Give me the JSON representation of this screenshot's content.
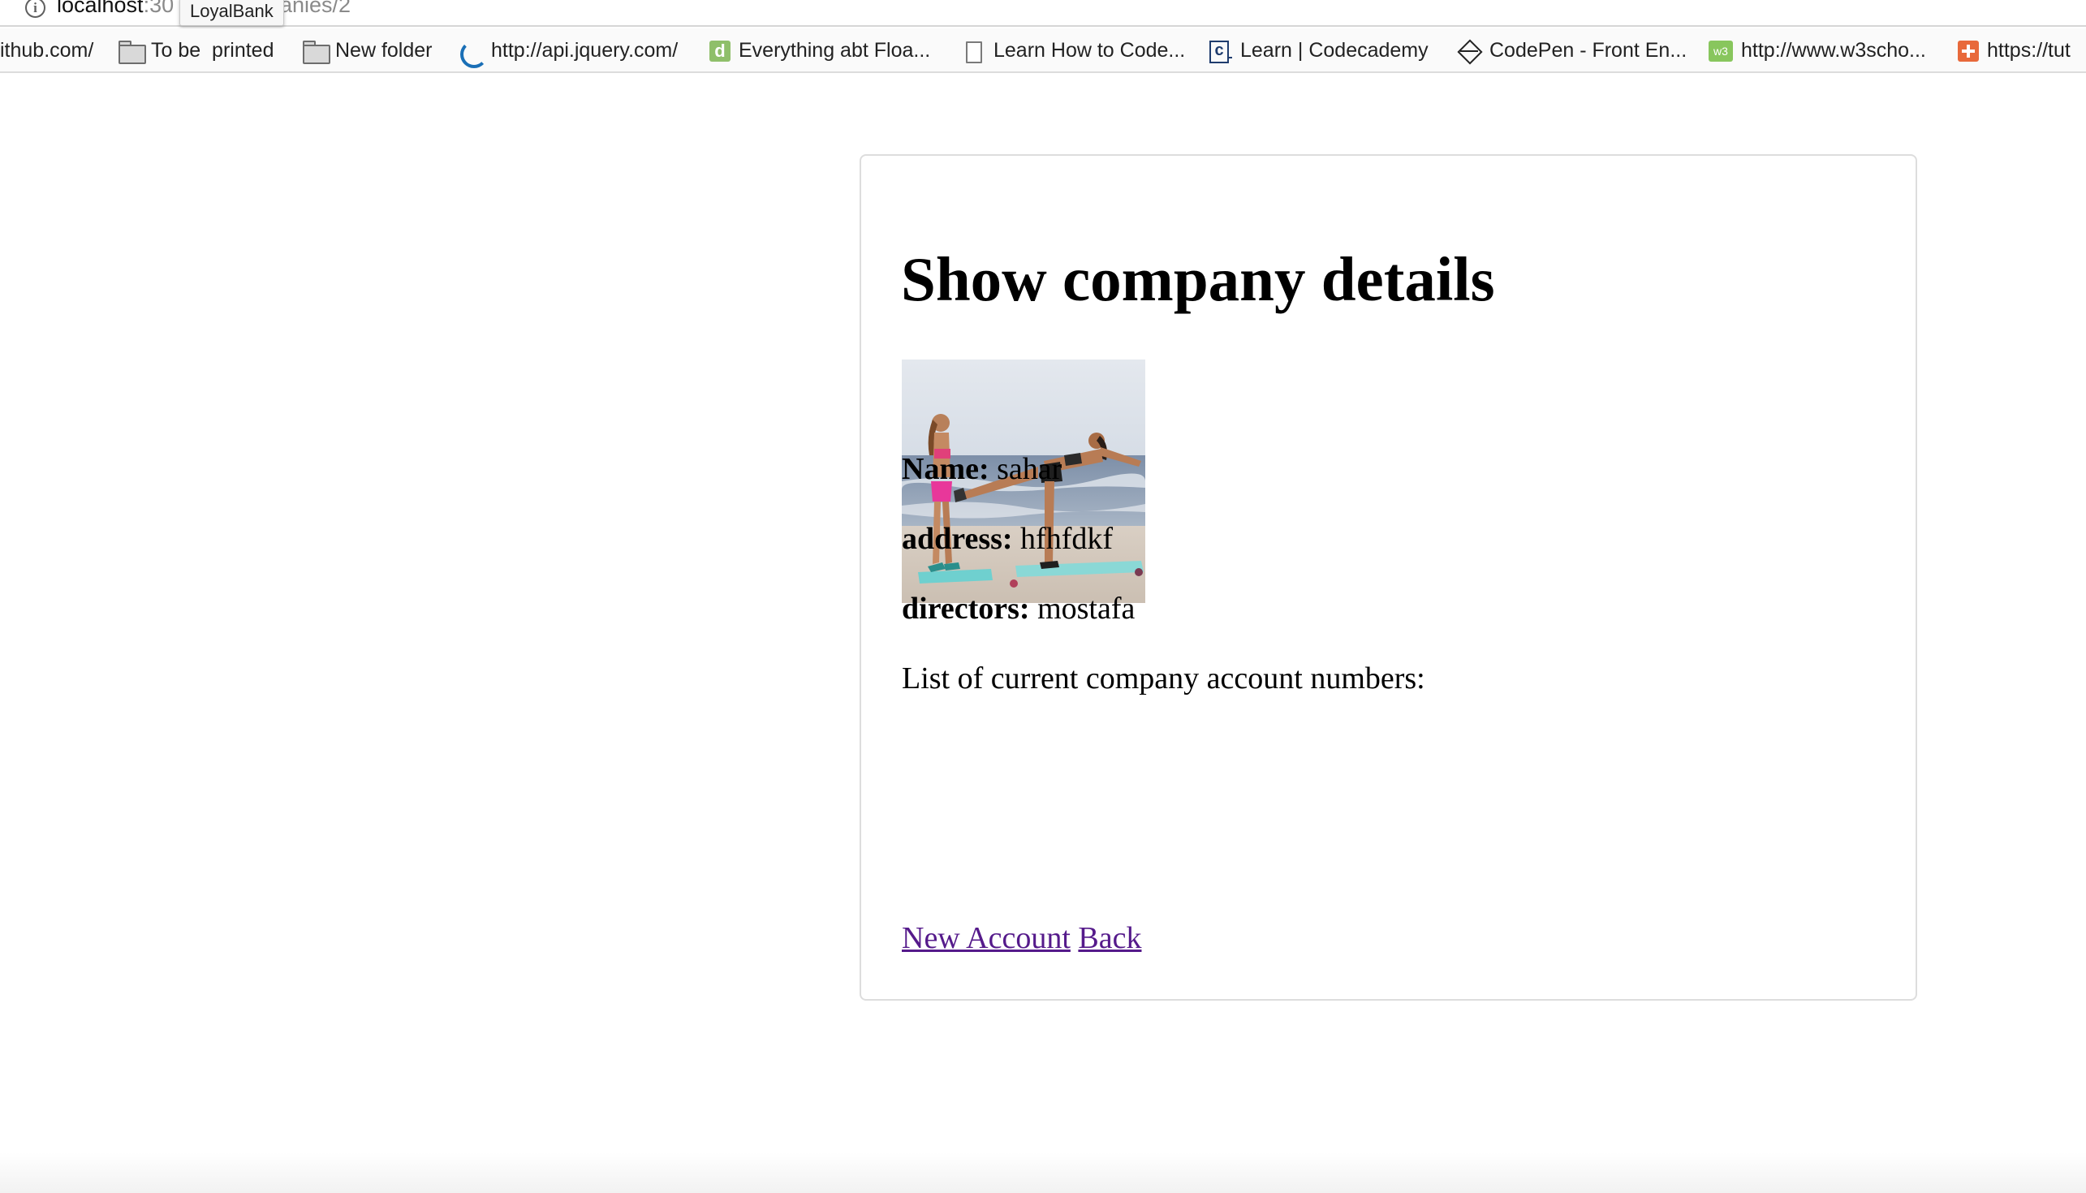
{
  "browser": {
    "url_host": "localhost",
    "url_port": ":30",
    "url_path": "anies/2",
    "tooltip": "LoyalBank"
  },
  "bookmarks": [
    {
      "label": "ithub.com/",
      "icon": "none"
    },
    {
      "label": "To be  printed",
      "icon": "folder-icon"
    },
    {
      "label": "New folder",
      "icon": "folder-icon"
    },
    {
      "label": "http://api.jquery.com/",
      "icon": "jquery-icon"
    },
    {
      "label": "Everything abt Floa...",
      "icon": "d-favicon"
    },
    {
      "label": "Learn How to Code...",
      "icon": "page-icon"
    },
    {
      "label": "Learn | Codecademy",
      "icon": "codecademy-icon"
    },
    {
      "label": "CodePen - Front En...",
      "icon": "codepen-icon"
    },
    {
      "label": "http://www.w3scho...",
      "icon": "w3schools-icon"
    },
    {
      "label": "https://tut",
      "icon": "plus-favicon"
    }
  ],
  "page": {
    "title": "Show company details",
    "photo_alt": "company-logo-photo",
    "fields": [
      {
        "label": "Name:",
        "value": "sahar"
      },
      {
        "label": "address:",
        "value": "hfhfdkf"
      },
      {
        "label": "directors:",
        "value": "mostafa"
      }
    ],
    "accounts_heading": "List of current company account numbers:",
    "links": {
      "new_account": "New Account",
      "back": "Back"
    }
  },
  "colors": {
    "link_visited": "#551a8b",
    "card_border": "#dddddd",
    "text": "#000000"
  }
}
